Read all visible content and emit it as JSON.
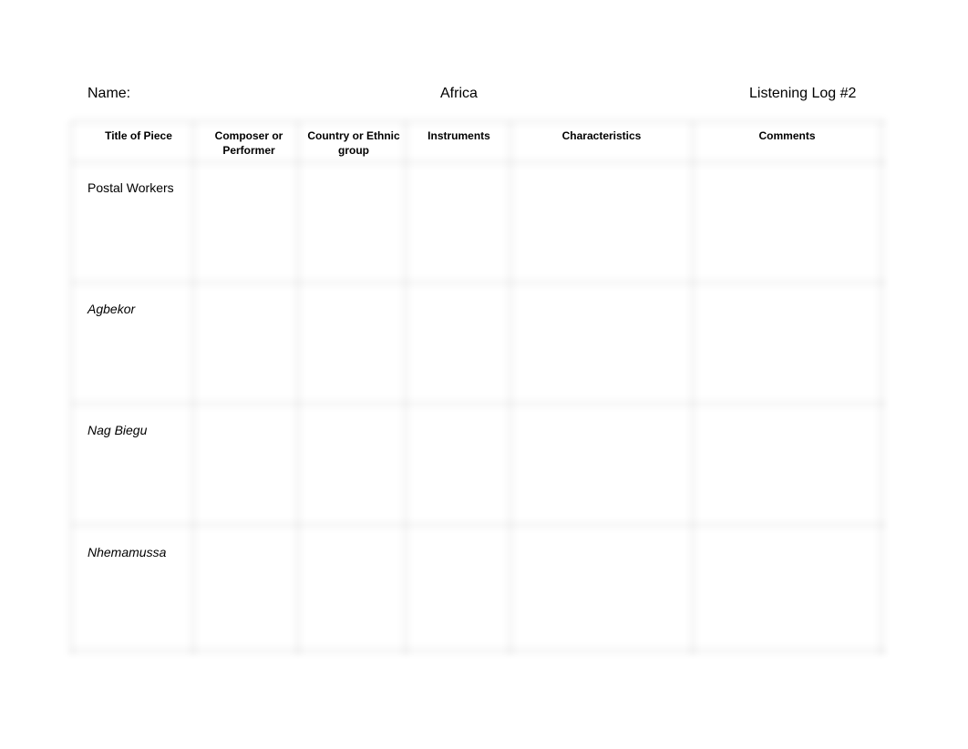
{
  "header": {
    "name_label": "Name:",
    "region": "Africa",
    "log_title": "Listening Log #2"
  },
  "table": {
    "columns": [
      "Title of Piece",
      "Composer or Performer",
      "Country or Ethnic group",
      "Instruments",
      "Characteristics",
      "Comments"
    ],
    "rows": [
      {
        "title": "Postal Workers",
        "italic": false,
        "composer": "",
        "country": "",
        "instruments": "",
        "characteristics": "",
        "comments": ""
      },
      {
        "title": "Agbekor",
        "italic": true,
        "composer": "",
        "country": "",
        "instruments": "",
        "characteristics": "",
        "comments": ""
      },
      {
        "title": "Nag Biegu",
        "italic": true,
        "composer": "",
        "country": "",
        "instruments": "",
        "characteristics": "",
        "comments": ""
      },
      {
        "title": "Nhemamussa",
        "italic": true,
        "composer": "",
        "country": "",
        "instruments": "",
        "characteristics": "",
        "comments": ""
      }
    ]
  }
}
